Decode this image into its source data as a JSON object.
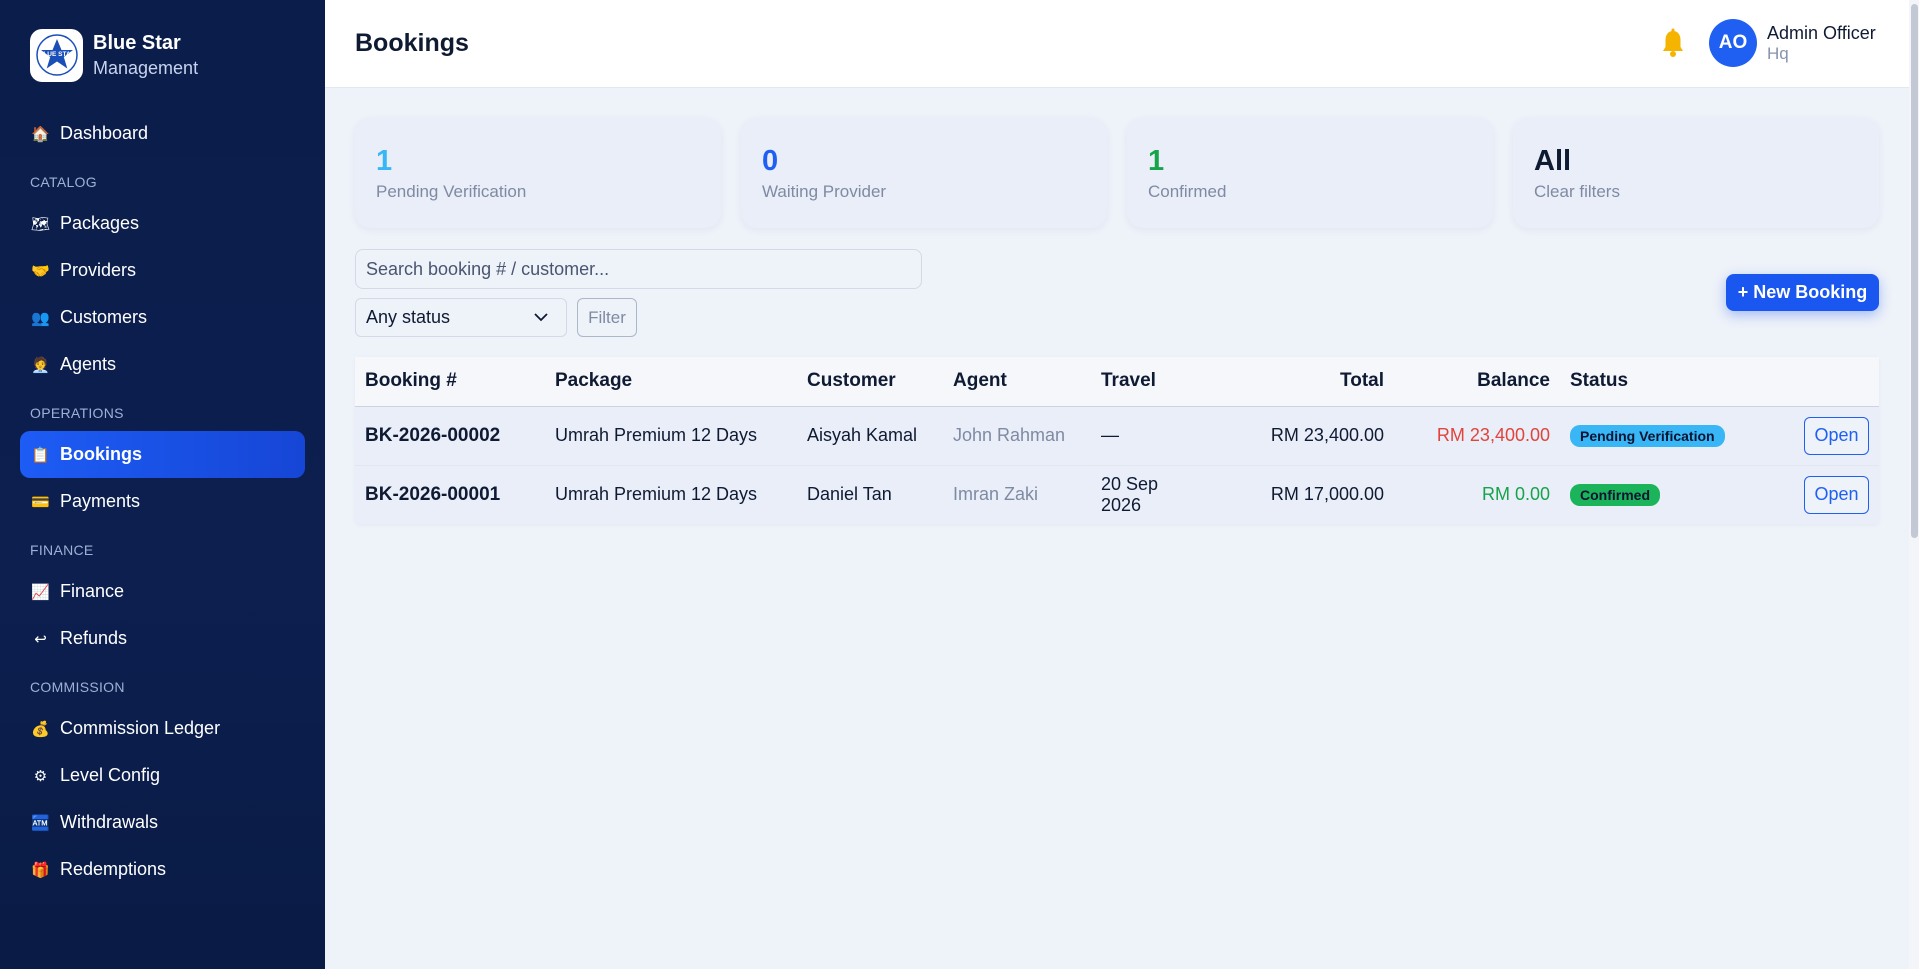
{
  "brand": {
    "name": "Blue Star",
    "sub": "Management",
    "logo_text": "BLUE STAR"
  },
  "sidebar": {
    "items": [
      {
        "label": "Dashboard",
        "icon": "🏠"
      },
      {
        "label": "Packages",
        "icon": "🗺"
      },
      {
        "label": "Providers",
        "icon": "🤝"
      },
      {
        "label": "Customers",
        "icon": "👥"
      },
      {
        "label": "Agents",
        "icon": "🧑‍💼"
      },
      {
        "label": "Bookings",
        "icon": "📋"
      },
      {
        "label": "Payments",
        "icon": "💳"
      },
      {
        "label": "Finance",
        "icon": "📈"
      },
      {
        "label": "Refunds",
        "icon": "↩"
      },
      {
        "label": "Commission Ledger",
        "icon": "💰"
      },
      {
        "label": "Level Config",
        "icon": "⚙"
      },
      {
        "label": "Withdrawals",
        "icon": "🏧"
      },
      {
        "label": "Redemptions",
        "icon": "🎁"
      }
    ],
    "sections": [
      "CATALOG",
      "OPERATIONS",
      "FINANCE",
      "COMMISSION"
    ],
    "active": "Bookings"
  },
  "header": {
    "title": "Bookings",
    "user_initials": "AO",
    "user_name": "Admin Officer",
    "user_role": "Hq",
    "bell_color": "#f5b400"
  },
  "stats": [
    {
      "value": "1",
      "label": "Pending Verification",
      "color": "#38b6f5"
    },
    {
      "value": "0",
      "label": "Waiting Provider",
      "color": "#1f5ff2"
    },
    {
      "value": "1",
      "label": "Confirmed",
      "color": "#16a34a"
    },
    {
      "value": "All",
      "label": "Clear filters",
      "color": "#0f1a33"
    }
  ],
  "filters": {
    "search_placeholder": "Search booking # / customer...",
    "status_value": "Any status",
    "filter_label": "Filter",
    "new_booking_label": "+ New Booking"
  },
  "table": {
    "columns": [
      "Booking #",
      "Package",
      "Customer",
      "Agent",
      "Travel",
      "Total",
      "Balance",
      "Status"
    ],
    "rows": [
      {
        "booking": "BK-2026-00002",
        "package": "Umrah Premium 12 Days",
        "customer": "Aisyah Kamal",
        "agent": "John Rahman",
        "travel": "—",
        "total": "RM 23,400.00",
        "balance": "RM 23,400.00",
        "status": "Pending Verification",
        "action": "Open"
      },
      {
        "booking": "BK-2026-00001",
        "package": "Umrah Premium 12 Days",
        "customer": "Daniel Tan",
        "agent": "Imran Zaki",
        "travel": "20 Sep 2026",
        "total": "RM 17,000.00",
        "balance": "RM 0.00",
        "status": "Confirmed",
        "action": "Open"
      }
    ]
  }
}
